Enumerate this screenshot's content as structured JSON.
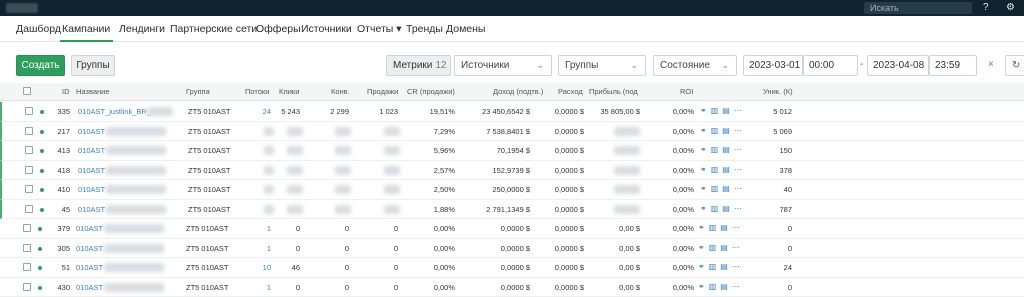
{
  "topbar": {
    "search_placeholder": "Искать",
    "help_icon": "?",
    "user_icon": "⚙"
  },
  "nav": {
    "items": [
      "Дашборд",
      "Кампании",
      "Лендинги",
      "Партнерские сети",
      "Офферы",
      "Источники",
      "Отчеты ▾",
      "Тренды",
      "Домены"
    ],
    "active": "Кампании"
  },
  "toolbar": {
    "create": "Создать",
    "groups": "Группы",
    "metrics": "Метрики",
    "metrics_count": "12",
    "filters": [
      {
        "label": "Источники"
      },
      {
        "label": "Группы"
      },
      {
        "label": "Состояние"
      }
    ],
    "date_from": "2023-03-01",
    "time_from": "00:00",
    "date_to": "2023-04-08",
    "time_to": "23:59",
    "dash": "-",
    "clear": "×"
  },
  "table": {
    "headers": {
      "id": "ID",
      "name": "Название",
      "group": "Группа",
      "streams": "Потоки",
      "clicks": "Клики",
      "conv": "Конв.",
      "sales": "Продажи",
      "cr": "CR (продажи)",
      "income": "Доход (подтв.)",
      "spend": "Расход",
      "profit": "Прибыль (под",
      "roi": "ROI",
      "uniq": "Уник. (К)"
    },
    "rows": [
      {
        "id": "335",
        "name": "010AST_justlink_BR_",
        "group": "ZT5 010AST",
        "streams": "24",
        "clicks": "5 243",
        "conv": "2 299",
        "sales": "1 023",
        "cr": "19,51%",
        "income": "23 450,6542 $",
        "spend": "0,0000 $",
        "profit": "35 805,00 $",
        "roi": "0,00%",
        "uniq": "5 012",
        "active": true
      },
      {
        "id": "217",
        "name": "010AST",
        "group": "ZT5 010AST",
        "streams": "",
        "clicks": "",
        "conv": "",
        "sales": "",
        "cr": "7,29%",
        "income": "7 538,8401 $",
        "spend": "0,0000 $",
        "profit": "",
        "roi": "0,00%",
        "uniq": "5 069",
        "active": true
      },
      {
        "id": "413",
        "name": "010AST",
        "group": "ZT5 010AST",
        "streams": "",
        "clicks": "",
        "conv": "",
        "sales": "",
        "cr": "5,96%",
        "income": "70,1954 $",
        "spend": "0,0000 $",
        "profit": "",
        "roi": "0,00%",
        "uniq": "150",
        "active": true
      },
      {
        "id": "418",
        "name": "010AST",
        "group": "ZT5 010AST",
        "streams": "",
        "clicks": "",
        "conv": "",
        "sales": "",
        "cr": "2,57%",
        "income": "152,9739 $",
        "spend": "0,0000 $",
        "profit": "",
        "roi": "0,00%",
        "uniq": "378",
        "active": true
      },
      {
        "id": "410",
        "name": "010AST",
        "group": "ZT5 010AST",
        "streams": "",
        "clicks": "",
        "conv": "",
        "sales": "",
        "cr": "2,50%",
        "income": "250,0000 $",
        "spend": "0,0000 $",
        "profit": "",
        "roi": "0,00%",
        "uniq": "40",
        "active": true
      },
      {
        "id": "45",
        "name": "010AST",
        "group": "ZT5 010AST",
        "streams": "",
        "clicks": "",
        "conv": "",
        "sales": "",
        "cr": "1,88%",
        "income": "2 791,1349 $",
        "spend": "0,0000 $",
        "profit": "",
        "roi": "0,00%",
        "uniq": "787",
        "active": true
      },
      {
        "id": "379",
        "name": "010AST",
        "group": "ZT5 010AST",
        "streams": "1",
        "clicks": "0",
        "conv": "0",
        "sales": "0",
        "cr": "0,00%",
        "income": "0,0000 $",
        "spend": "0,0000 $",
        "profit": "0,00 $",
        "roi": "0,00%",
        "uniq": "0",
        "active": false
      },
      {
        "id": "305",
        "name": "010AST",
        "group": "ZT5 010AST",
        "streams": "1",
        "clicks": "0",
        "conv": "0",
        "sales": "0",
        "cr": "0,00%",
        "income": "0,0000 $",
        "spend": "0,0000 $",
        "profit": "0,00 $",
        "roi": "0,00%",
        "uniq": "0",
        "active": false
      },
      {
        "id": "51",
        "name": "010AST",
        "group": "ZT5 010AST",
        "streams": "10",
        "clicks": "46",
        "conv": "0",
        "sales": "0",
        "cr": "0,00%",
        "income": "0,0000 $",
        "spend": "0,0000 $",
        "profit": "0,00 $",
        "roi": "0,00%",
        "uniq": "24",
        "active": false
      },
      {
        "id": "430",
        "name": "010AST",
        "group": "ZT5 010AST",
        "streams": "1",
        "clicks": "0",
        "conv": "0",
        "sales": "0",
        "cr": "0,00%",
        "income": "0,0000 $",
        "spend": "0,0000 $",
        "profit": "0,00 $",
        "roi": "0,00%",
        "uniq": "0",
        "active": false
      }
    ]
  },
  "colors": {
    "accent": "#2f9e5d",
    "link": "#3a7fc1",
    "active_dot": "#2f9e5d",
    "inactive_dot": "#2f9e5d"
  }
}
